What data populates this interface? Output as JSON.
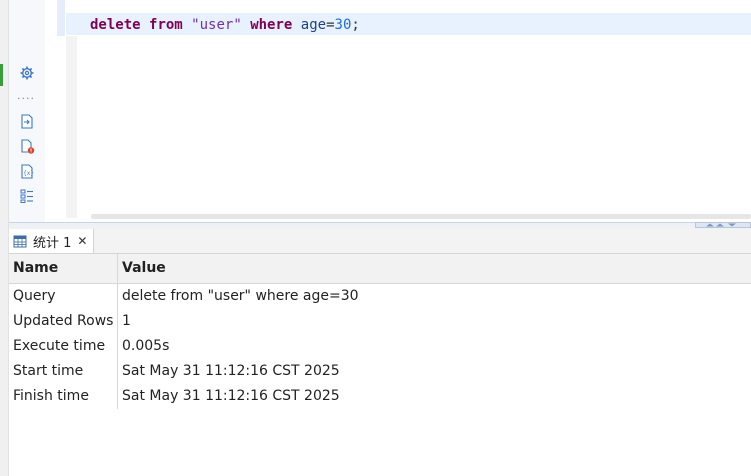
{
  "editor": {
    "code": {
      "kw_delete": "delete",
      "kw_from": "from",
      "table": "\"user\"",
      "kw_where": "where",
      "column": "age",
      "op": "=",
      "value": "30",
      "end": ";"
    },
    "gutter_dots": "...."
  },
  "colors": {
    "keyword": "#7f0055",
    "string": "#6f2fb0",
    "identifier": "#1d3f8f",
    "number": "#1e6dd9",
    "line_highlight": "#e8f2fe"
  },
  "results": {
    "tab_label": "统计 1",
    "tab_close": "✕",
    "columns": [
      "Name",
      "Value"
    ],
    "rows": [
      {
        "name": "Query",
        "value": "delete from \"user\" where age=30"
      },
      {
        "name": "Updated Rows",
        "value": "1"
      },
      {
        "name": "Execute time",
        "value": "0.005s"
      },
      {
        "name": "Start time",
        "value": "Sat May 31 11:12:16 CST 2025"
      },
      {
        "name": "Finish time",
        "value": "Sat May 31 11:12:16 CST 2025"
      }
    ]
  },
  "icons": {
    "gutter": [
      "gear-icon",
      "export-icon",
      "script-error-icon",
      "variables-icon",
      "outline-icon"
    ],
    "tab": "grid-table-icon"
  }
}
